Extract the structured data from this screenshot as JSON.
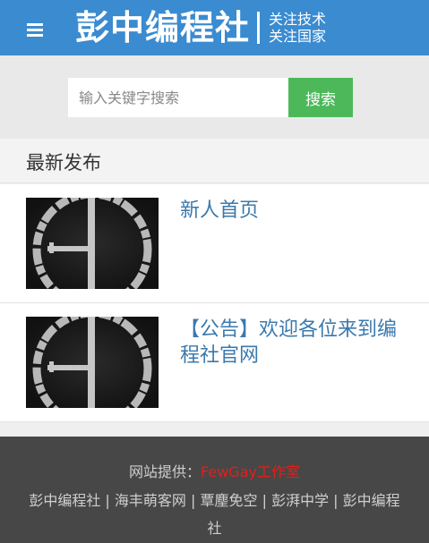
{
  "header": {
    "menu_icon": "hamburger-icon",
    "logo_main": "彭中编程社",
    "slogan_line1": "关注技术",
    "slogan_line2": "关注国家",
    "background": "#3a8bd0"
  },
  "search": {
    "placeholder": "输入关键字搜索",
    "value": "",
    "button_label": "搜索",
    "button_color": "#4cb85a"
  },
  "section": {
    "title": "最新发布"
  },
  "posts": [
    {
      "title": "新人首页",
      "thumbnail_icon": "logo-thumbnail-icon"
    },
    {
      "title": "【公告】欢迎各位来到编程社官网",
      "thumbnail_icon": "logo-thumbnail-icon"
    }
  ],
  "footer": {
    "provided_by_label": "网站提供：",
    "provider": "FewGay工作室",
    "provider_color": "#e0201a",
    "links": [
      "彭中编程社",
      "海丰萌客网",
      "覃麈免空",
      "彭湃中学",
      "彭中编程社"
    ],
    "separator": " | "
  }
}
